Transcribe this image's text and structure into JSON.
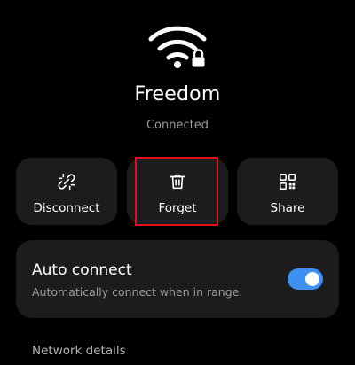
{
  "network": {
    "name": "Freedom",
    "status": "Connected",
    "icon": "wifi-locked-icon"
  },
  "actions": {
    "disconnect": {
      "label": "Disconnect",
      "icon": "unlink-icon"
    },
    "forget": {
      "label": "Forget",
      "icon": "trash-icon"
    },
    "share": {
      "label": "Share",
      "icon": "qr-code-icon"
    }
  },
  "auto_connect": {
    "title": "Auto connect",
    "subtitle": "Automatically connect when in range.",
    "enabled": true
  },
  "network_details": {
    "label": "Network details"
  },
  "colors": {
    "background": "#000000",
    "card": "#1c1c1e",
    "accent": "#3e91f3",
    "highlight": "#e0101a",
    "secondary_text": "#9a9a9a"
  }
}
